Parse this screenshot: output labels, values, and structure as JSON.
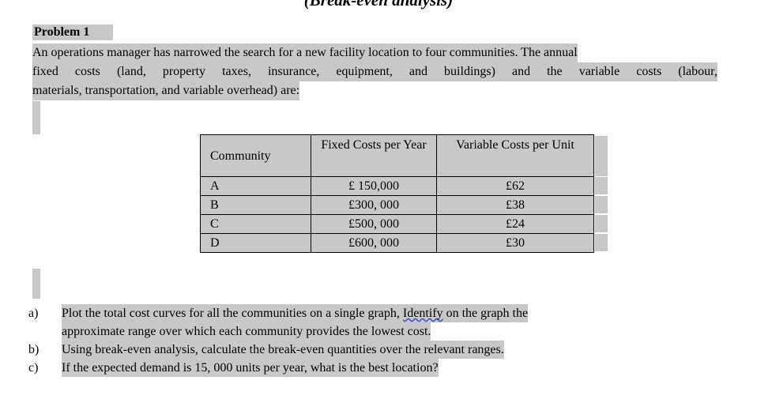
{
  "document": {
    "title": "(Break-even analysis)",
    "heading": "Problem 1",
    "intro": {
      "line1": "An operations manager has narrowed the search for a new facility location to four communities. The annual",
      "line2_a": "fixed",
      "line2_b": "costs",
      "line2_c": "(land,",
      "line2_d": "property",
      "line2_e": "taxes,",
      "line2_f": "insurance,",
      "line2_g": "equipment,",
      "line2_h": "and",
      "line2_i": "buildings)",
      "line2_j": "and",
      "line2_k": "the",
      "line2_l": "variable",
      "line2_m": "costs",
      "line2_n": "(labour,",
      "line3": "materials, transportation, and variable overhead) are:"
    }
  },
  "table": {
    "headers": {
      "community": "Community",
      "fixed_costs": "Fixed Costs per Year",
      "variable_costs": "Variable Costs per Unit"
    },
    "rows": [
      {
        "community": "A",
        "fixed_costs": "£ 150,000",
        "variable_costs": "£62"
      },
      {
        "community": "B",
        "fixed_costs": "£300, 000",
        "variable_costs": "£38"
      },
      {
        "community": "C",
        "fixed_costs": "£500, 000",
        "variable_costs": "£24"
      },
      {
        "community": "D",
        "fixed_costs": "£600, 000",
        "variable_costs": "£30"
      }
    ]
  },
  "questions": [
    {
      "marker": "a)",
      "line1_pre": "Plot the total cost curves for all the communities on a single graph, ",
      "line1_misspelled": "Identify",
      "line1_post": " on the graph the",
      "line2": "approximate range over which each community provides the lowest cost."
    },
    {
      "marker": "b)",
      "line1": "Using break-even analysis, calculate the break-even quantities over the relevant ranges."
    },
    {
      "marker": "c)",
      "line1": "If the expected demand is 15, 000 units per year, what is the best location?"
    }
  ],
  "colors": {
    "selection_highlight": "#c8c8c8",
    "page_background": "#ffffff",
    "text": "#000000",
    "spellcheck_underline": "#3b5bdb",
    "table_border": "#000000"
  }
}
